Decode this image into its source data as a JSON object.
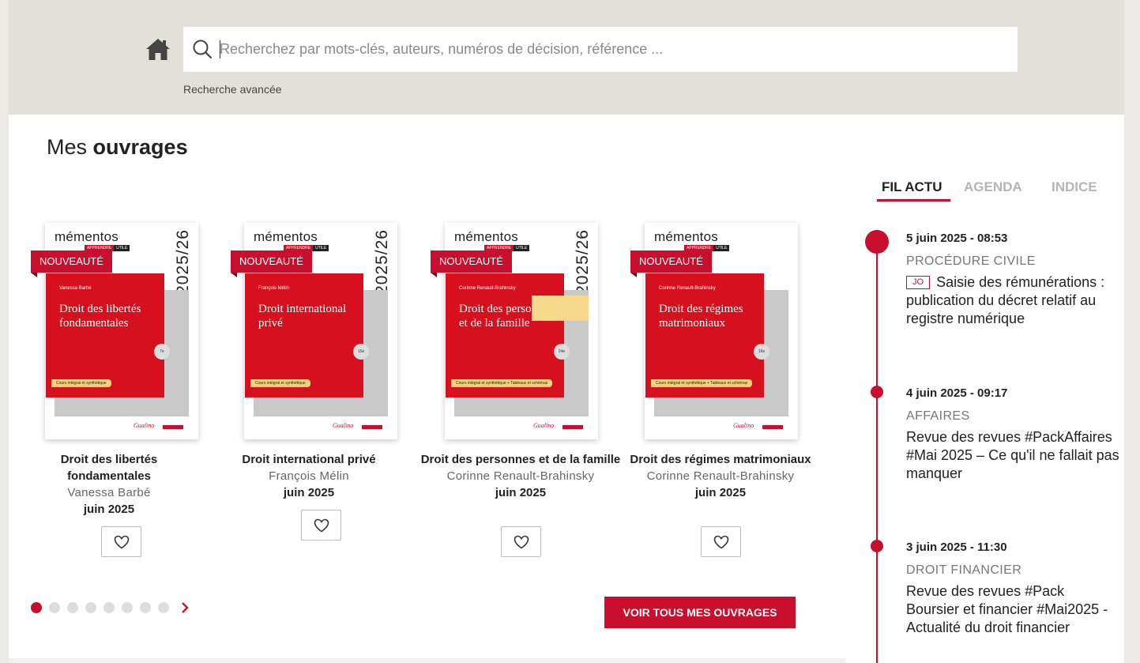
{
  "search": {
    "placeholder": "Recherchez par mots-clés, auteurs, numéros de décision, référence ...",
    "advanced_label": "Recherche avancée"
  },
  "section": {
    "title_light": "Mes",
    "title_bold": "ouvrages"
  },
  "books": [
    {
      "badge": "NOUVEAUTÉ",
      "cover_brand": "mémentos",
      "cover_year": "2025/26",
      "cover_author": "Vanessa Barbé",
      "cover_title": "Droit des libertés fondamentales",
      "cover_tag": "Cours intégral et synthétique",
      "cover_edition": "7e",
      "title": "Droit des libertés fondamentales",
      "author": "Vanessa Barbé",
      "date": "juin 2025"
    },
    {
      "badge": "NOUVEAUTÉ",
      "cover_brand": "mémentos",
      "cover_year": "2025/26",
      "cover_author": "François Mélin",
      "cover_title": "Droit international privé",
      "cover_tag": "Cours intégral et synthétique",
      "cover_edition": "15e",
      "title": "Droit international privé",
      "author": "François Mélin",
      "date": "juin 2025"
    },
    {
      "badge": "NOUVEAUTÉ",
      "cover_brand": "mémentos",
      "cover_year": "2025/26",
      "cover_author": "Corinne Renault-Brahinsky",
      "cover_title": "Droit des personnes et de la famille",
      "cover_tag": "Cours intégral et synthétique + Tableaux et schémas",
      "cover_edition": "24e",
      "title": "Droit des personnes et de la famille",
      "author": "Corinne Renault-Brahinsky",
      "date": "juin 2025"
    },
    {
      "badge": "NOUVEAUTÉ",
      "cover_brand": "mémentos",
      "cover_year": "2025/26",
      "cover_author": "Corinne Renault-Brahinsky",
      "cover_title": "Droit des régimes matrimoniaux",
      "cover_tag": "Cours intégral et synthétique + Tableaux et schémas",
      "cover_edition": "16e",
      "title": "Droit des régimes matrimoniaux",
      "author": "Corinne Renault-Brahinsky",
      "date": "juin 2025"
    }
  ],
  "carousel": {
    "cta_label": "VOIR TOUS MES OUVRAGES"
  },
  "news_tabs": {
    "active": "FIL ACTU",
    "agenda": "AGENDA",
    "indice": "INDICE"
  },
  "news": [
    {
      "date": "5 juin 2025 - 08:53",
      "category": "PROCÉDURE CIVILE",
      "tag": "JO",
      "text": "Saisie des rémunérations : publication du décret relatif au registre numérique"
    },
    {
      "date": "4 juin 2025 - 09:17",
      "category": "AFFAIRES",
      "text": "Revue des revues #PackAffaires #Mai 2025 – Ce qu'il ne fallait pas manquer"
    },
    {
      "date": "3 juin 2025 - 11:30",
      "category": "DROIT FINANCIER",
      "text": "Revue des revues #Pack Boursier et financier #Mai2025 - Actualité du droit financier"
    }
  ],
  "colors": {
    "accent": "#c8102e",
    "topbar": "#e3e0da"
  }
}
